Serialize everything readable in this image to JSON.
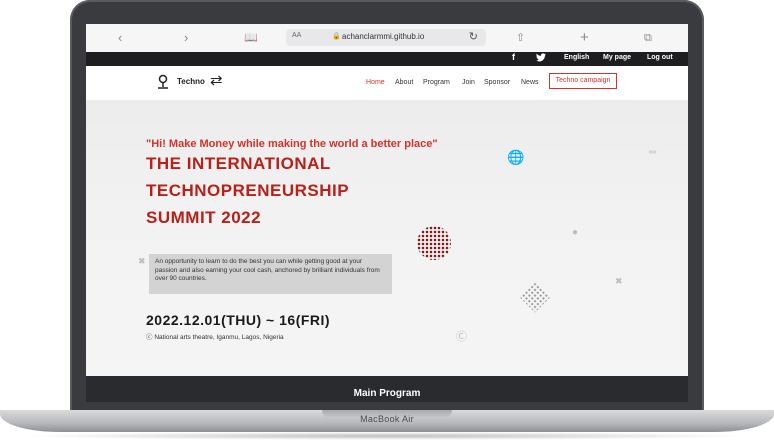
{
  "browser": {
    "back_icon": "chevron-left-icon",
    "forward_icon": "chevron-right-icon",
    "reader_icon": "book-icon",
    "text_size_label": "AA",
    "url": "achanclarmmi.github.io",
    "reload_icon": "reload-icon",
    "share_icon": "share-icon",
    "new_tab_icon": "plus-icon",
    "tabs_icon": "tabs-icon"
  },
  "util_bar": {
    "facebook_icon": "f",
    "twitter_icon": "twitter-bird",
    "language": "English",
    "my_page": "My page",
    "logout": "Log out"
  },
  "header": {
    "logo_text": "Techno",
    "nav": [
      "Home",
      "About",
      "Program",
      "Join",
      "Sponsor",
      "News"
    ],
    "cta": "Techno campaign"
  },
  "hero": {
    "tagline": "\"Hi! Make Money while making the world a better place\"",
    "title_lines": [
      "THE INTERNATIONAL",
      "TECHNOPRENEURSHIP",
      "SUMMIT 2022"
    ],
    "description": "An opportunity to learn to do the best you can while getting good at your passion and also earning your cool cash, anchored by brilliant individuals from over 90 countries.",
    "date": "2022.12.01(THU) ~ 16(FRI)",
    "venue": "National arts theatre, Iganmu, Lagos, Nigeria"
  },
  "section": {
    "title": "Main Program"
  },
  "device": {
    "label": "MacBook Air"
  },
  "colors": {
    "accent": "#d0342c",
    "title_red": "#b8201a",
    "dark_bar": "#1e1e20"
  }
}
